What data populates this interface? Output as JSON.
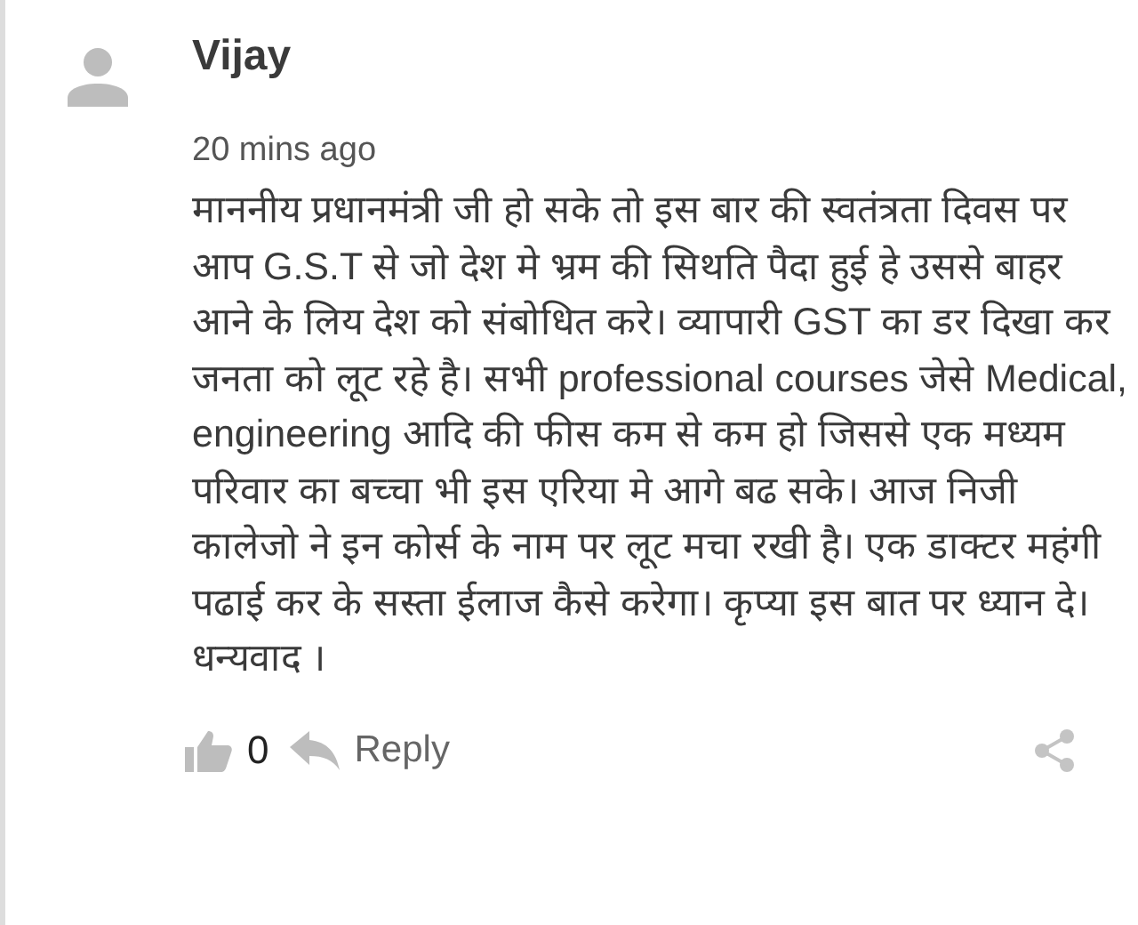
{
  "comment": {
    "author": "Vijay",
    "time": "20 mins ago",
    "text": "माननीय प्रधानमंत्री जी हो सके तो इस बार की स्वतंत्रता दिवस पर आप G.S.T से जो देश मे भ्रम की सिथति पैदा हुई हे उससे बाहर आने के लिय देश को संबोधित करे। व्यापारी GST का डर दिखा कर जनता को लूट रहे है। सभी professional courses जेसे Medical, engineering आदि की फीस कम से कम हो जिससे एक मध्यम परिवार का बच्चा भी इस एरिया मे आगे बढ सके। आज निजी कालेजो ने इन कोर्स के नाम पर लूट मचा रखी है। एक डाक्टर महंगी पढाई कर के सस्ता ईलाज कैसे करेगा। कृप्या इस बात पर ध्यान दे। धन्यवाद ।",
    "likes": "0",
    "reply": "Reply"
  }
}
